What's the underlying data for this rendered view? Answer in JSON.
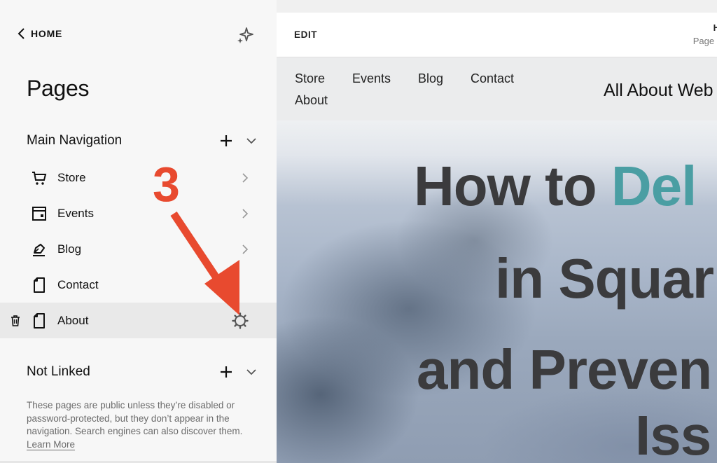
{
  "sidebar": {
    "home_label": "HOME",
    "title": "Pages",
    "main_navigation": {
      "title": "Main Navigation",
      "items": [
        {
          "label": "Store",
          "icon": "cart-icon",
          "has_chevron": true
        },
        {
          "label": "Events",
          "icon": "calendar-icon",
          "has_chevron": true
        },
        {
          "label": "Blog",
          "icon": "pen-icon",
          "has_chevron": true
        },
        {
          "label": "Contact",
          "icon": "page-icon",
          "has_chevron": false
        },
        {
          "label": "About",
          "icon": "page-icon",
          "has_chevron": false,
          "active": true
        }
      ]
    },
    "not_linked": {
      "title": "Not Linked",
      "description": "These pages are public unless they’re disabled or password-protected, but they don’t appear in the navigation. Search engines can also discover them.",
      "learn_more": "Learn More"
    }
  },
  "annotation": {
    "step_number": "3",
    "color": "#e84a2f"
  },
  "preview": {
    "edit_label": "EDIT",
    "header_title_fragment": "H",
    "header_sub_fragment": "Page ·",
    "site_nav": [
      "Store",
      "Events",
      "Blog",
      "Contact",
      "About"
    ],
    "site_brand": "All About Web",
    "headline": {
      "line1_dark": "How to ",
      "line1_accent": "Del",
      "line2": "in Squar",
      "line3": "and Preven",
      "line4": "Iss"
    },
    "accent_color": "#4a9ea3",
    "headline_color": "#3b3b3d"
  }
}
